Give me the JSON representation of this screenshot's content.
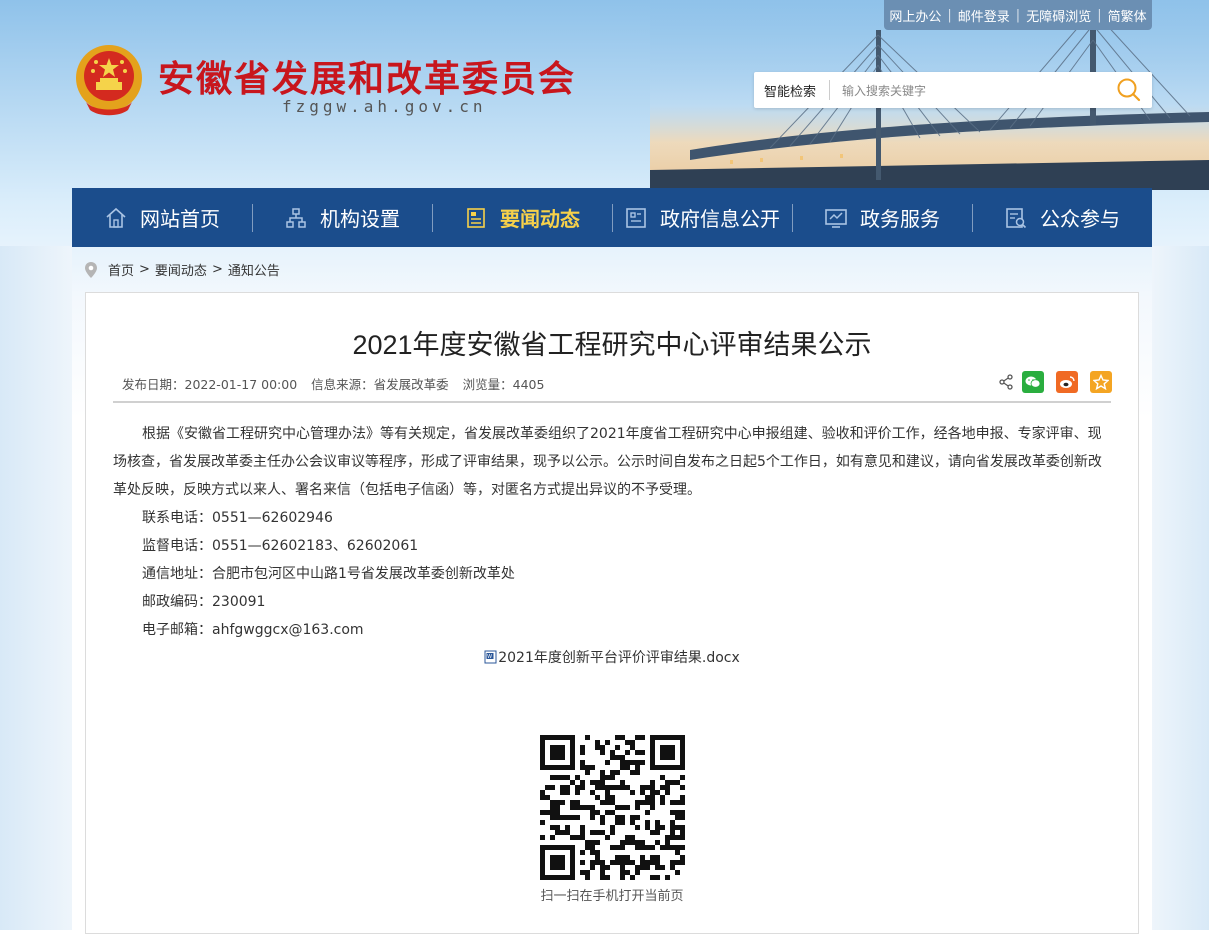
{
  "top_links": [
    "网上办公",
    "邮件登录",
    "无障碍浏览",
    "简繁体"
  ],
  "header": {
    "title": "安徽省发展和改革委员会",
    "domain": "fzggw.ah.gov.cn"
  },
  "search": {
    "label": "智能检索",
    "placeholder": "输入搜索关键字"
  },
  "nav": [
    {
      "label": "网站首页",
      "icon": "home-icon"
    },
    {
      "label": "机构设置",
      "icon": "org-icon"
    },
    {
      "label": "要闻动态",
      "icon": "news-icon",
      "active": true
    },
    {
      "label": "政府信息公开",
      "icon": "info-icon"
    },
    {
      "label": "政务服务",
      "icon": "service-icon"
    },
    {
      "label": "公众参与",
      "icon": "participate-icon"
    }
  ],
  "breadcrumb": [
    "首页",
    "要闻动态",
    "通知公告"
  ],
  "article": {
    "title": "2021年度安徽省工程研究中心评审结果公示",
    "publish_date": "发布日期：2022-01-17 00:00",
    "source": "信息来源：省发展改革委",
    "views": "浏览量：4405",
    "paragraph": "根据《安徽省工程研究中心管理办法》等有关规定，省发展改革委组织了2021年度省工程研究中心申报组建、验收和评价工作，经各地申报、专家评审、现场核查，省发展改革委主任办公会议审议等程序，形成了评审结果，现予以公示。公示时间自发布之日起5个工作日，如有意见和建议，请向省发展改革委创新改革处反映，反映方式以来人、署名来信（包括电子信函）等，对匿名方式提出异议的不予受理。",
    "contact_phone": "联系电话：0551—62602946",
    "supervise_phone": "监督电话：0551—62602183、62602061",
    "address": "通信地址：合肥市包河区中山路1号省发展改革委创新改革处",
    "postcode": "邮政编码：230091",
    "email": "电子邮箱：ahfgwggcx@163.com",
    "attachment": "2021年度创新平台评价评审结果.docx"
  },
  "share_icons": [
    "share-icon",
    "wechat-icon",
    "weibo-icon",
    "favorite-icon"
  ],
  "qr_caption": "扫一扫在手机打开当前页",
  "colors": {
    "nav_bg": "#1b4d8c",
    "nav_active": "#f7d14a",
    "title_red": "#c8161d",
    "wechat": "#2aae3f",
    "weibo": "#f06a24",
    "favorite": "#f4a523"
  }
}
